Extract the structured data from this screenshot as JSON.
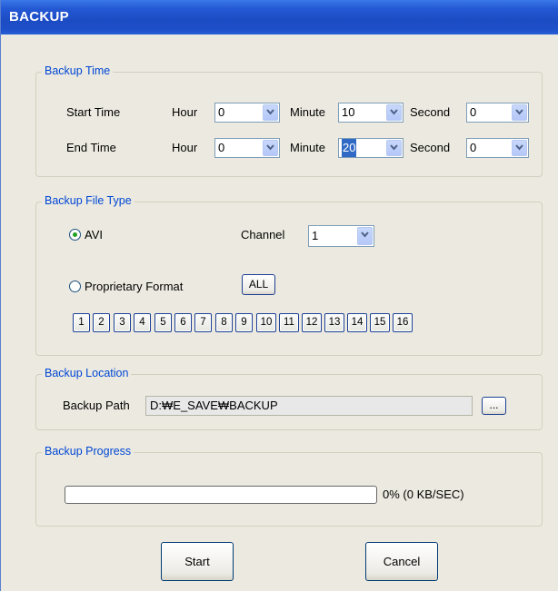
{
  "window": {
    "title": "BACKUP"
  },
  "backup_time": {
    "legend": "Backup Time",
    "start": {
      "label": "Start Time",
      "hour_label": "Hour",
      "hour": "0",
      "minute_label": "Minute",
      "minute": "10",
      "second_label": "Second",
      "second": "0"
    },
    "end": {
      "label": "End Time",
      "hour_label": "Hour",
      "hour": "0",
      "minute_label": "Minute",
      "minute": "20",
      "second_label": "Second",
      "second": "0"
    }
  },
  "file_type": {
    "legend": "Backup File Type",
    "avi_label": "AVI",
    "avi_selected": true,
    "channel_label": "Channel",
    "channel": "1",
    "proprietary_label": "Proprietary Format",
    "all_label": "ALL",
    "channels": [
      "1",
      "2",
      "3",
      "4",
      "5",
      "6",
      "7",
      "8",
      "9",
      "10",
      "11",
      "12",
      "13",
      "14",
      "15",
      "16"
    ]
  },
  "location": {
    "legend": "Backup Location",
    "path_label": "Backup Path",
    "path_value": "D:₩E_SAVE₩BACKUP",
    "browse_label": "..."
  },
  "progress": {
    "legend": "Backup Progress",
    "fraction": 0,
    "status": "0% (0 KB/SEC)"
  },
  "buttons": {
    "start": "Start",
    "cancel": "Cancel"
  },
  "colors": {
    "accent": "#0046d5",
    "title_bar": "#1d4fc8",
    "radio_dot": "#21a121"
  }
}
